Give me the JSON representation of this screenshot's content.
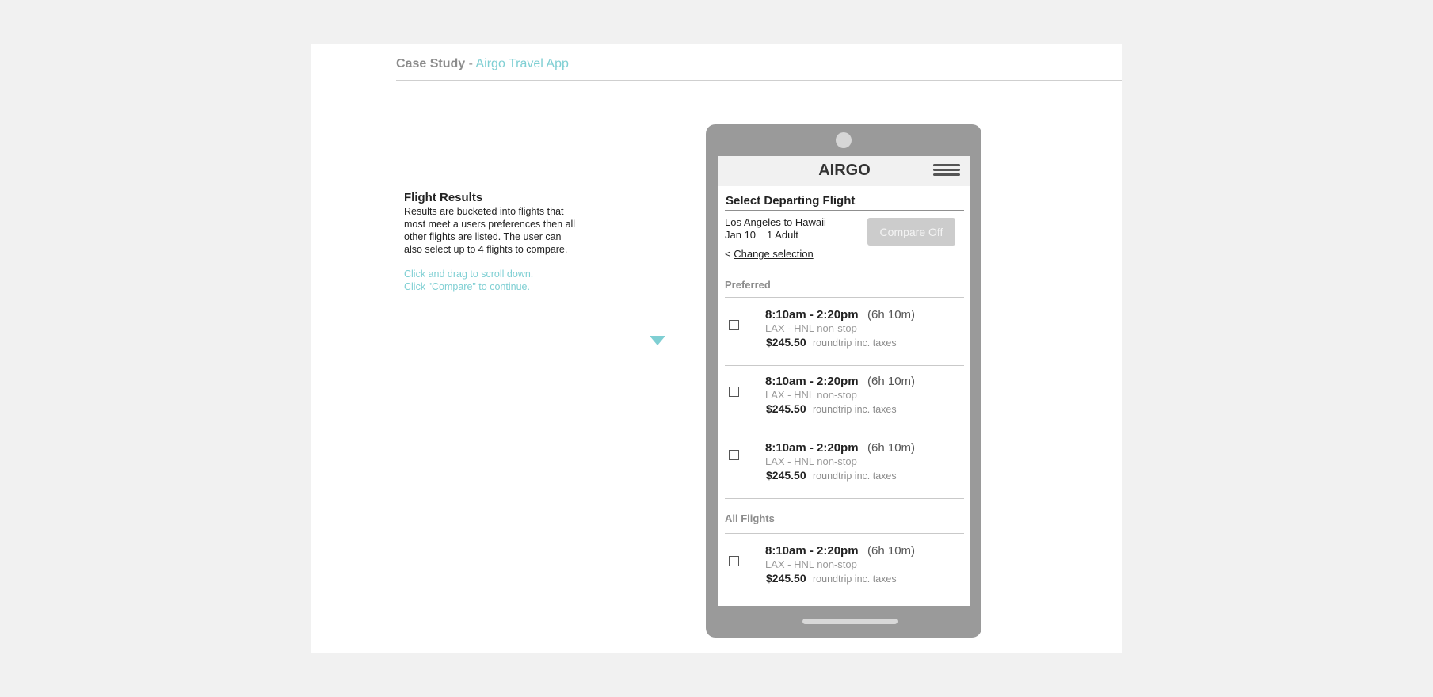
{
  "header": {
    "case_study": "Case Study",
    "dash": "-",
    "app_name": "Airgo Travel App"
  },
  "description": {
    "title": "Flight Results",
    "body": "Results are bucketed into flights that most meet a users preferences then all other flights are listed. The user can also select up to 4 flights to compare.",
    "hint_line1": "Click and drag to scroll down.",
    "hint_line2": "Click \"Compare\" to continue."
  },
  "phone": {
    "app_title": "AIRGO",
    "section_title": "Select Departing Flight",
    "route": "Los Angeles to Hawaii",
    "date": "Jan 10",
    "passengers": "1 Adult",
    "compare_button": "Compare Off",
    "change_prefix": "<",
    "change_selection": "Change selection",
    "buckets": [
      {
        "label": "Preferred",
        "flights": [
          {
            "times": "8:10am - 2:20pm",
            "duration": "(6h 10m)",
            "airports": "LAX - HNL  non-stop",
            "price": "$245.50",
            "price_note": "roundtrip inc. taxes"
          },
          {
            "times": "8:10am - 2:20pm",
            "duration": "(6h 10m)",
            "airports": "LAX - HNL  non-stop",
            "price": "$245.50",
            "price_note": "roundtrip inc. taxes"
          },
          {
            "times": "8:10am - 2:20pm",
            "duration": "(6h 10m)",
            "airports": "LAX - HNL  non-stop",
            "price": "$245.50",
            "price_note": "roundtrip inc. taxes"
          }
        ]
      },
      {
        "label": "All Flights",
        "flights": [
          {
            "times": "8:10am - 2:20pm",
            "duration": "(6h 10m)",
            "airports": "LAX - HNL  non-stop",
            "price": "$245.50",
            "price_note": "roundtrip inc. taxes"
          }
        ]
      }
    ]
  },
  "colors": {
    "accent": "#7fcfd3",
    "phone_body": "#9a9a9a",
    "button_disabled": "#cccccc"
  },
  "icons": {
    "menu": "hamburger-menu-icon",
    "scroll": "scroll-down-arrow-icon"
  }
}
